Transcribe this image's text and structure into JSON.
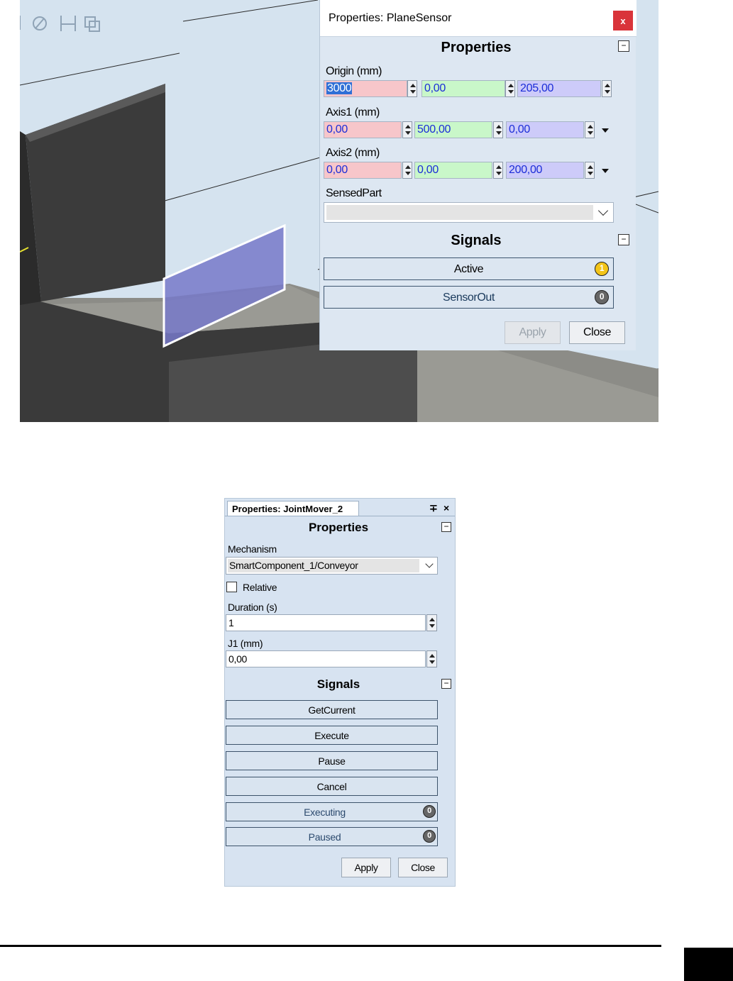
{
  "viewport": {
    "toolbar_icons": [
      "select-icon",
      "orbit-icon",
      "fit-icon",
      "view-icon"
    ]
  },
  "plane_sensor": {
    "title": "Properties: PlaneSensor",
    "close_label": "x",
    "properties_header": "Properties",
    "collapse_symbol": "−",
    "origin": {
      "label": "Origin (mm)",
      "x": "3000",
      "y": "0,00",
      "z": "205,00"
    },
    "axis1": {
      "label": "Axis1 (mm)",
      "x": "0,00",
      "y": "500,00",
      "z": "0,00"
    },
    "axis2": {
      "label": "Axis2 (mm)",
      "x": "0,00",
      "y": "0,00",
      "z": "200,00"
    },
    "sensed_part": {
      "label": "SensedPart",
      "value": ""
    },
    "signals_header": "Signals",
    "signals": [
      {
        "name": "Active",
        "value": "1"
      },
      {
        "name": "SensorOut",
        "value": "0"
      }
    ],
    "apply_label": "Apply",
    "close_button_label": "Close"
  },
  "joint_mover": {
    "tab_title": "Properties: JointMover_2",
    "pin_symbol": "∓",
    "close_symbol": "×",
    "properties_header": "Properties",
    "collapse_symbol": "−",
    "mechanism": {
      "label": "Mechanism",
      "value": "SmartComponent_1/Conveyor"
    },
    "relative": {
      "label": "Relative",
      "checked": false
    },
    "duration": {
      "label": "Duration (s)",
      "value": "1"
    },
    "j1": {
      "label": "J1 (mm)",
      "value": "0,00"
    },
    "signals_header": "Signals",
    "signal_buttons": [
      "GetCurrent",
      "Execute",
      "Pause",
      "Cancel"
    ],
    "status_signals": [
      {
        "name": "Executing",
        "value": "0"
      },
      {
        "name": "Paused",
        "value": "0"
      }
    ],
    "apply_label": "Apply",
    "close_label": "Close"
  },
  "colors": {
    "pink_field": "#f7c6ca",
    "green_field": "#c9f7c9",
    "blue_field": "#cdcbf9",
    "value_text": "#1b2dd8",
    "close_red": "#d9343a",
    "led_on": "#f3c418"
  }
}
